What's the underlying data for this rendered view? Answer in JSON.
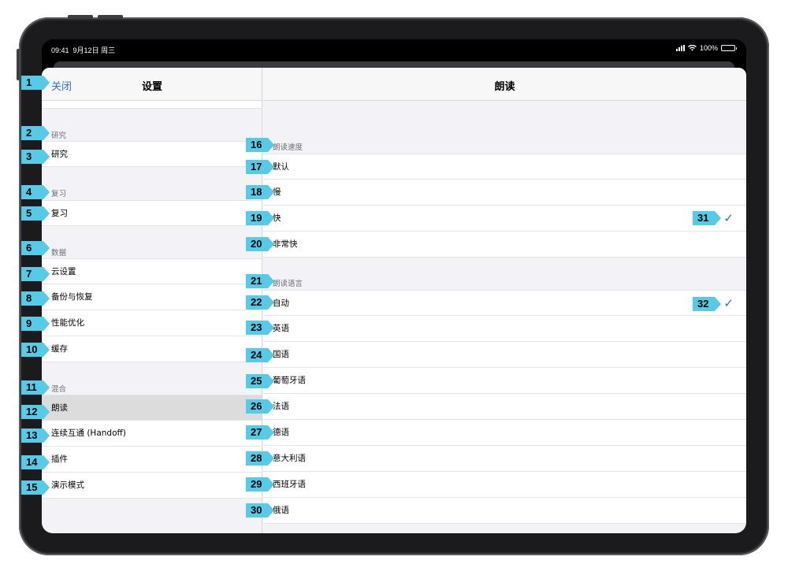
{
  "status_bar": {
    "time": "09:41",
    "date": "9月12日 周三",
    "battery": "100%"
  },
  "left_pane": {
    "close_label": "关闭",
    "title": "设置",
    "sections": {
      "research": {
        "header": "研究",
        "items": [
          "研究"
        ]
      },
      "review": {
        "header": "复习",
        "items": [
          "复习"
        ]
      },
      "data": {
        "header": "数据",
        "items": [
          "云设置",
          "备份与恢复",
          "性能优化",
          "缓存"
        ]
      },
      "misc": {
        "header": "混合",
        "items": [
          "朗读",
          "连续互通 (Handoff)",
          "插件",
          "演示模式"
        ]
      }
    },
    "selected_item": "朗读"
  },
  "right_pane": {
    "title": "朗读",
    "speed": {
      "header": "朗读速度",
      "items": [
        "默认",
        "慢",
        "快",
        "非常快"
      ],
      "selected": "快"
    },
    "language": {
      "header": "朗读语言",
      "items": [
        "自动",
        "英语",
        "国语",
        "葡萄牙语",
        "法语",
        "德语",
        "意大利语",
        "西班牙语",
        "俄语"
      ],
      "selected": "自动"
    }
  },
  "icons": {
    "checkmark": "checkmark-icon",
    "wifi": "wifi-icon",
    "signal": "cellular-signal-icon",
    "battery": "battery-icon"
  },
  "colors": {
    "accent": "#2f6fd6",
    "badge": "#55cbe8",
    "selected_row": "#dcdcdc"
  },
  "badges": [
    "1",
    "2",
    "3",
    "4",
    "5",
    "6",
    "7",
    "8",
    "9",
    "10",
    "11",
    "12",
    "13",
    "14",
    "15",
    "16",
    "17",
    "18",
    "19",
    "20",
    "21",
    "22",
    "23",
    "24",
    "25",
    "26",
    "27",
    "28",
    "29",
    "30",
    "31",
    "32"
  ]
}
